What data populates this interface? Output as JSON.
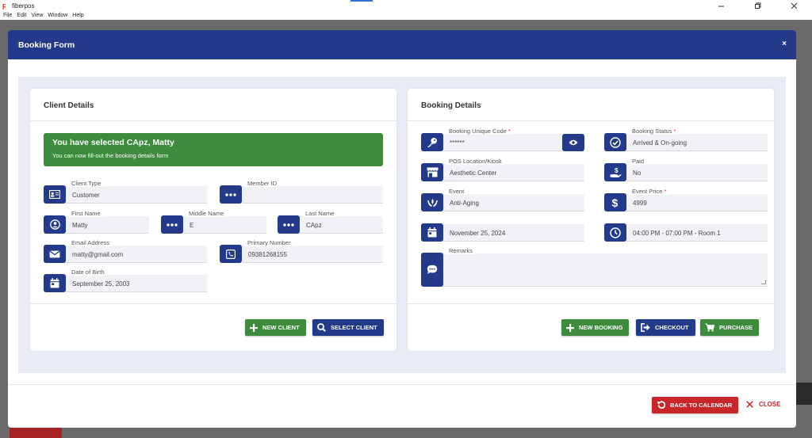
{
  "window": {
    "app_title": "fiberpos",
    "menu": [
      "File",
      "Edit",
      "View",
      "Window",
      "Help"
    ]
  },
  "modal": {
    "title": "Booking Form",
    "close_x": "×"
  },
  "client": {
    "title": "Client Details",
    "banner_title": "You have selected CApz, Matty",
    "banner_sub": "You can now fill-out the booking details form",
    "fields": {
      "client_type": {
        "label": "Client Type",
        "value": "Customer"
      },
      "member_id": {
        "label": "Member ID",
        "value": ""
      },
      "first_name": {
        "label": "First Name",
        "value": "Matty"
      },
      "middle_name": {
        "label": "Middle Name",
        "value": "E"
      },
      "last_name": {
        "label": "Last Name",
        "value": "CApz"
      },
      "email": {
        "label": "Email Address",
        "value": "matty@gmail.com"
      },
      "primary_number": {
        "label": "Primary Number",
        "value": "09381268155"
      },
      "dob": {
        "label": "Date of Birth",
        "value": "September 25, 2003"
      }
    },
    "buttons": {
      "new_client": "NEW CLIENT",
      "select_client": "SELECT CLIENT"
    }
  },
  "booking": {
    "title": "Booking Details",
    "fields": {
      "unique_code": {
        "label": "Booking Unique Code",
        "required": "*",
        "value": "******"
      },
      "status": {
        "label": "Booking Status",
        "required": "*",
        "value": "Arrived & On-going"
      },
      "location": {
        "label": "POS Location/Kiosk",
        "value": "Aesthetic Center"
      },
      "paid": {
        "label": "Paid",
        "value": "No"
      },
      "event": {
        "label": "Event",
        "value": "Anti-Aging"
      },
      "price": {
        "label": "Event Price",
        "required": "*",
        "value": "4999"
      },
      "date": {
        "value": "November 25, 2024"
      },
      "time": {
        "value": "04:00 PM - 07:00 PM - Room 1"
      },
      "remarks": {
        "label": "Remarks",
        "value": ""
      }
    },
    "buttons": {
      "new_booking": "NEW BOOKING",
      "checkout": "CHECKOUT",
      "purchase": "PURCHASE"
    }
  },
  "footer": {
    "back_to_calendar": "BACK TO CALENDAR",
    "close": "CLOSE"
  },
  "colors": {
    "navy": "#23398a",
    "green": "#3d8b3d",
    "red": "#c8262b"
  }
}
